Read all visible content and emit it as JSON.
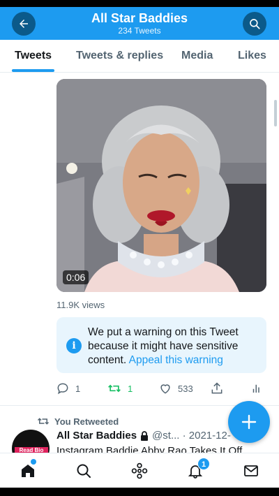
{
  "header": {
    "title": "All Star Baddies",
    "subtitle": "234 Tweets"
  },
  "tabs": [
    {
      "label": "Tweets",
      "active": true
    },
    {
      "label": "Tweets & replies",
      "active": false
    },
    {
      "label": "Media",
      "active": false
    },
    {
      "label": "Likes",
      "active": false
    }
  ],
  "tweet": {
    "video_duration": "0:06",
    "views": "11.9K views",
    "warning": {
      "text": "We put a warning on this Tweet because it might have sensitive content.",
      "link": "Appeal this warning"
    },
    "actions": {
      "replies": "1",
      "retweets": "1",
      "likes": "533"
    }
  },
  "next_tweet": {
    "retweet_label": "You Retweeted",
    "name": "All Star Baddies",
    "handle": "@st... · 2021-12-",
    "body": "Instagram Baddie Abby Rao Takes It Off",
    "avatar_text": "Read Bio"
  },
  "notifications_badge": "1",
  "colors": {
    "accent": "#1d9bf0",
    "retweet_green": "#17bf63",
    "secondary_text": "#536471"
  }
}
